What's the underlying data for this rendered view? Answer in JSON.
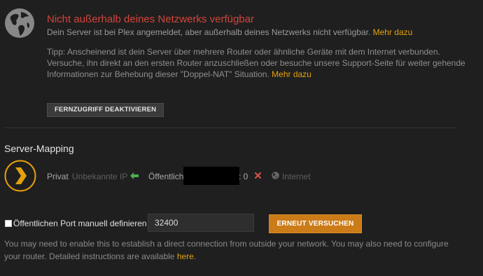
{
  "remote_access": {
    "status_title": "Nicht außerhalb deines Netzwerks verfügbar",
    "status_desc": "Dein Server ist bei Plex angemeldet, aber außerhalb deines Netzwerks nicht verfügbar.",
    "status_link": "Mehr dazu",
    "tip_text": "Tipp: Anscheinend ist dein Server über mehrere Router oder ähnliche Geräte mit dem Internet verbunden. Versuche, ihn direkt an den ersten Router anzuschließen oder besuche unsere Support-Seite für weiter gehende Informationen zur Behebung dieser \"Doppel-NAT\" Situation.",
    "tip_link": "Mehr dazu",
    "disable_button": "FERNZUGRIFF DEAKTIVIEREN"
  },
  "server_mapping": {
    "title": "Server-Mapping",
    "private_label": "Privat",
    "private_value": "Unbekannte IP",
    "public_label": "Öffentlich",
    "public_port_suffix": ": 0",
    "internet_label": "Internet"
  },
  "manual_port": {
    "checkbox_label": "Öffentlichen Port manuell definieren",
    "checked": false,
    "port_value": "32400",
    "retry_button": "ERNEUT VERSUCHEN",
    "help_text": "You may need to enable this to establish a direct connection from outside your network. You may also need to configure your router. Detailed instructions are available",
    "help_link": "here",
    "help_end": "."
  },
  "colors": {
    "background": "#1f1f1f",
    "error_red": "#d3453a",
    "accent_orange": "#e5a00d",
    "button_orange": "#cc7b19",
    "arrow_green": "#4caf50",
    "x_red": "#d9534f"
  },
  "icons": {
    "status": "globe-icon",
    "server": "plex-chevron-icon",
    "private_to_public": "arrow-left-icon",
    "connection_error": "x-icon",
    "internet": "globe-small-icon"
  }
}
